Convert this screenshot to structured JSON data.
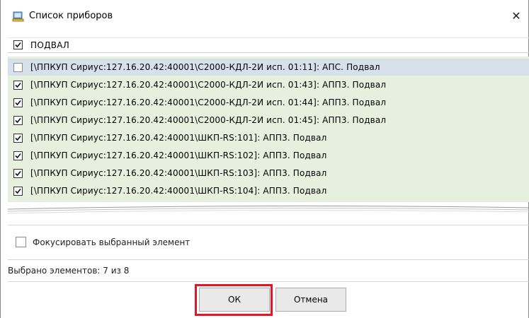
{
  "dialog": {
    "title": "Список приборов",
    "close_symbol": "✕",
    "icon": "device-list-icon"
  },
  "filter": {
    "checked": true,
    "value": "ПОДВАЛ"
  },
  "list": {
    "items": [
      {
        "label": "[\\ППКУП Сириус:127.16.20.42:40001\\С2000-КДЛ-2И исп. 01:11]: АПС. Подвал",
        "checked": false,
        "selected": true
      },
      {
        "label": "[\\ППКУП Сириус:127.16.20.42:40001\\С2000-КДЛ-2И исп. 01:43]: АПП3. Подвал",
        "checked": true,
        "selected": false
      },
      {
        "label": "[\\ППКУП Сириус:127.16.20.42:40001\\С2000-КДЛ-2И исп. 01:44]: АПП3. Подвал",
        "checked": true,
        "selected": false
      },
      {
        "label": "[\\ППКУП Сириус:127.16.20.42:40001\\С2000-КДЛ-2И исп. 01:45]: АПП3. Подвал",
        "checked": true,
        "selected": false
      },
      {
        "label": "[\\ППКУП Сириус:127.16.20.42:40001\\ШКП-RS:101]: АПП3. Подвал",
        "checked": true,
        "selected": false
      },
      {
        "label": "[\\ППКУП Сириус:127.16.20.42:40001\\ШКП-RS:102]: АПП3. Подвал",
        "checked": true,
        "selected": false
      },
      {
        "label": "[\\ППКУП Сириус:127.16.20.42:40001\\ШКП-RS:103]: АПП3. Подвал",
        "checked": true,
        "selected": false
      },
      {
        "label": "[\\ППКУП Сириус:127.16.20.42:40001\\ШКП-RS:104]: АПП3. Подвал",
        "checked": true,
        "selected": false
      }
    ]
  },
  "focus_option": {
    "label": "Фокусировать выбранный элемент",
    "checked": false
  },
  "status": {
    "text": "Выбрано элементов: 7 из 8"
  },
  "buttons": {
    "ok_label": "ОК",
    "cancel_label": "Отмена"
  },
  "colors": {
    "list_background": "#e7f0df",
    "selected_row": "#d7e1ec",
    "highlight_border": "#e0162b"
  }
}
